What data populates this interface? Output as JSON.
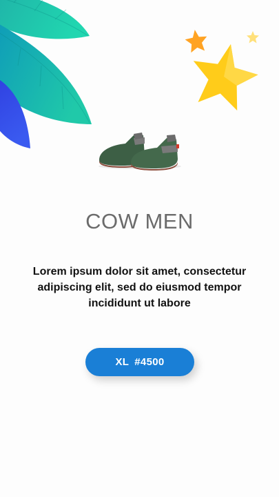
{
  "product": {
    "image_icon": "baby-shoes-image",
    "name": "COW MEN",
    "description": "Lorem ipsum dolor sit amet, consectetur adipiscing elit, sed do eiusmod tempor incididunt ut labore"
  },
  "price_button": {
    "size": "XL",
    "price": "#4500"
  },
  "decor": {
    "leaves_icon": "leaves-decoration-icon",
    "stars_icon": "stars-decoration-icon"
  },
  "colors": {
    "button": "#1a7fd6",
    "title": "#6b6b6b",
    "star_yellow": "#ffcc1a",
    "star_orange": "#ffa323",
    "leaf_teal": "#1cc0a8",
    "leaf_blue": "#3346e6"
  }
}
